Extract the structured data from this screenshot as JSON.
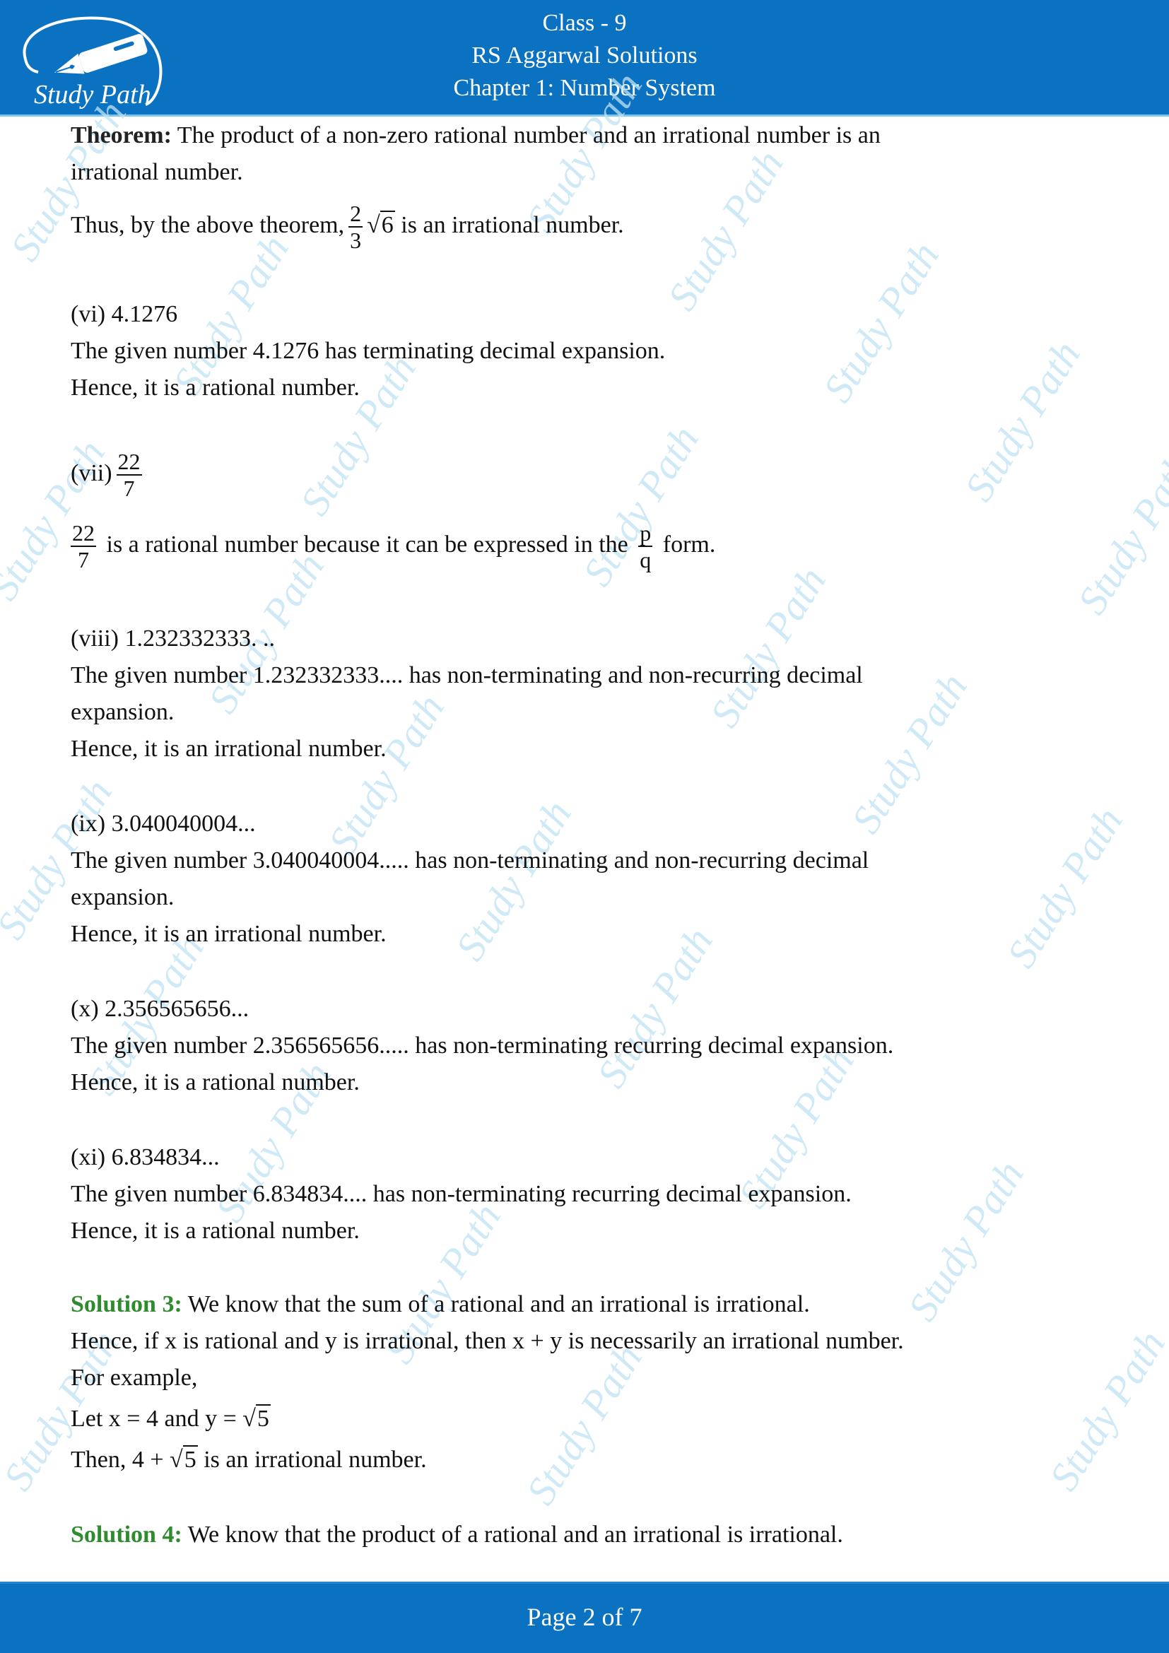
{
  "header": {
    "logo_text": "Study Path",
    "class_line": "Class - 9",
    "book_line": "RS Aggarwal Solutions",
    "chapter_line": "Chapter 1: Number System"
  },
  "watermark_text": "Study Path",
  "content": {
    "theorem": {
      "label": "Theorem:",
      "text_1": " The product of a non-zero rational number and an irrational number is an",
      "text_2": "irrational number.",
      "thus_prefix": "Thus, by the above theorem,",
      "frac_num": "2",
      "frac_den": "3",
      "sqrt_sym": "√",
      "sqrt_val": "6",
      "thus_suffix": " is an irrational number."
    },
    "parts": [
      {
        "heading": "(vi) 4.1276",
        "lines": [
          "The given number 4.1276 has terminating decimal expansion.",
          "Hence, it is a rational number."
        ]
      },
      {
        "heading_prefix": "(vii)",
        "heading_frac_num": "22",
        "heading_frac_den": "7",
        "body_frac_num": "22",
        "body_frac_den": "7",
        "body_text": " is a rational number because it can be expressed in the ",
        "pq_num": "p",
        "pq_den": "q",
        "body_suffix": " form."
      },
      {
        "heading": "(viii) 1.232332333. ..",
        "lines": [
          "The given number 1.232332333.... has non-terminating and non-recurring decimal",
          "expansion.",
          "Hence, it is an irrational number."
        ]
      },
      {
        "heading": "(ix) 3.040040004...",
        "lines": [
          "The given number 3.040040004..... has non-terminating and non-recurring decimal",
          "expansion.",
          "Hence, it is an irrational number."
        ]
      },
      {
        "heading": "(x) 2.356565656...",
        "lines": [
          "The given number 2.356565656..... has non-terminating recurring decimal expansion.",
          "Hence, it is a rational number."
        ]
      },
      {
        "heading": "(xi) 6.834834...",
        "lines": [
          "The given number 6.834834.... has non-terminating recurring decimal expansion.",
          "Hence, it is a rational number."
        ]
      }
    ],
    "solution3": {
      "label": "Solution 3:",
      "text": " We know that the sum of a rational and an irrational is irrational.",
      "line2": "Hence, if x is rational and y is irrational, then x + y is necessarily an irrational number.",
      "line3": "For example,",
      "line4_prefix": "Let x = 4 and y = ",
      "sqrt_sym": "√",
      "sqrt_val": "5",
      "line5_prefix": "Then, 4 + ",
      "line5_suffix": " is an irrational number."
    },
    "solution4": {
      "label": "Solution 4:",
      "text": " We know that the product of a rational and an irrational is irrational."
    }
  },
  "footer": {
    "page_label": "Page 2 of 7"
  },
  "colors": {
    "header_blue": "#0b72c1",
    "solution_green": "#2e8b2e",
    "watermark": "#bfe3f3"
  }
}
